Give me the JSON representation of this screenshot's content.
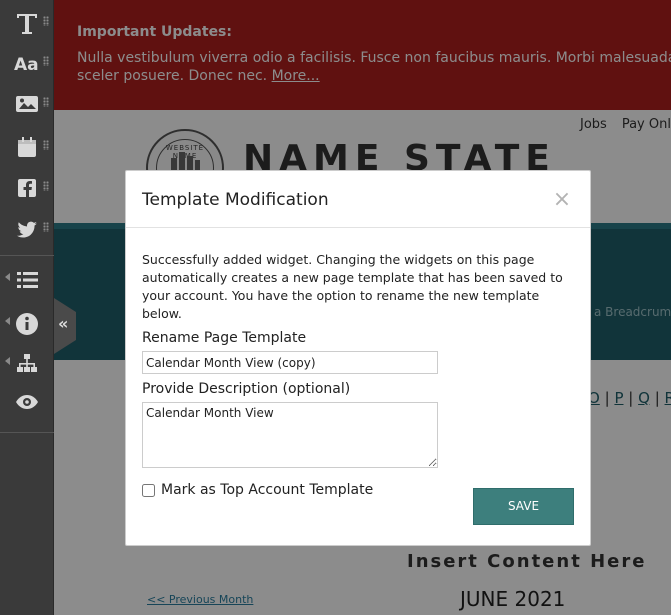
{
  "alert": {
    "title": "Important Updates:",
    "text": "Nulla vestibulum viverra odio a facilisis. Fusce non faucibus mauris. Morbi malesuada sceler posuere. Donec nec. ",
    "more_link": "More..."
  },
  "utility_nav": [
    "Jobs",
    "Pay Onl"
  ],
  "seal_text": "WEBSITE NAME",
  "site_name": "NAME  STATE",
  "teal_crumb": "a Breadcrumb",
  "alphabet": [
    "O",
    "|",
    "P",
    "|",
    "Q",
    "|",
    "R"
  ],
  "insert_content": "Insert Content Here",
  "previous_month": "<< Previous Month",
  "month_title": "JUNE 2021",
  "sidebar": {
    "items": [
      {
        "name": "text-widget",
        "icon": "text-icon"
      },
      {
        "name": "font-widget",
        "icon": "font-icon"
      },
      {
        "name": "image-widget",
        "icon": "image-icon"
      },
      {
        "name": "calendar-widget",
        "icon": "calendar-icon"
      },
      {
        "name": "facebook-widget",
        "icon": "facebook-icon"
      },
      {
        "name": "twitter-widget",
        "icon": "twitter-icon"
      },
      {
        "name": "list-widget",
        "icon": "list-icon"
      },
      {
        "name": "info-widget",
        "icon": "info-icon"
      },
      {
        "name": "sitemap-widget",
        "icon": "sitemap-icon"
      },
      {
        "name": "preview-widget",
        "icon": "eye-icon"
      }
    ],
    "collapse_glyph": "«"
  },
  "modal": {
    "title": "Template Modification",
    "close_glyph": "×",
    "message": "Successfully added widget. Changing the widgets on this page automatically creates a new page template that has been saved to your account. You have the option to rename the new template below.",
    "rename_label": "Rename Page Template",
    "rename_value": "Calendar Month View (copy)",
    "description_label": "Provide Description (optional)",
    "description_value": "Calendar Month View",
    "top_template_label": "Mark as Top Account Template",
    "top_template_checked": false,
    "save_label": "SAVE"
  },
  "colors": {
    "alert_bg": "#b0201e",
    "teal": "#1f5f6b",
    "save_button": "#3d7f7d",
    "sidebar_bg": "#3a3a3a"
  }
}
